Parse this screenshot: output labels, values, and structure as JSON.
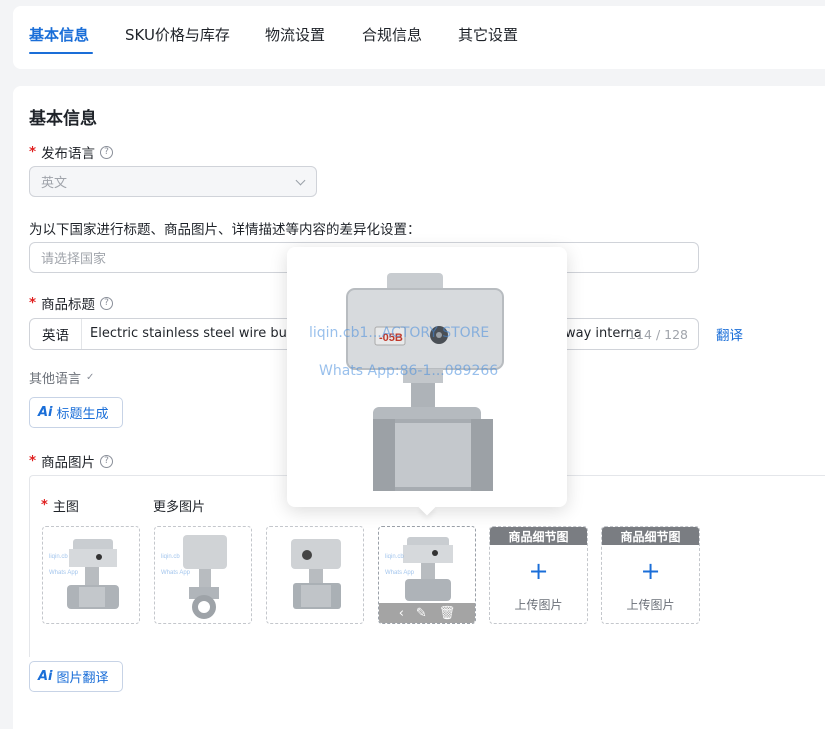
{
  "tabs": [
    {
      "label": "基本信息",
      "active": true
    },
    {
      "label": "SKU价格与库存",
      "active": false
    },
    {
      "label": "物流设置",
      "active": false
    },
    {
      "label": "合规信息",
      "active": false
    },
    {
      "label": "其它设置",
      "active": false
    }
  ],
  "basic": {
    "section_title": "基本信息",
    "language": {
      "label": "发布语言",
      "value": "英文"
    },
    "country": {
      "label": "为以下国家进行标题、商品图片、详情描述等内容的差异化设置：",
      "placeholder": "请选择国家"
    },
    "title": {
      "label": "商品标题",
      "lang": "英语",
      "value_head": "Electric stainless steel wire buckl",
      "value_tail": "way interna",
      "counter": "114 / 128",
      "translate_label": "翻译"
    },
    "other_lang_label": "其他语言",
    "ai_title_label": "标题生成",
    "ai_mark": "Ai",
    "images": {
      "label": "商品图片",
      "main_label": "主图",
      "more_label": "更多图片",
      "detail_head": "商品细节图",
      "upload_label": "上传图片",
      "plus": "+",
      "ai_translate_label": "图片翻译"
    }
  },
  "popover": {
    "watermark_1": "liqin.cb1...ACTORY STORE",
    "watermark_2": "Whats App:86-1...089266",
    "valve_code": "-05B"
  },
  "icons": {
    "help": "help-circle-icon",
    "chevron": "chevron-down-icon",
    "edit": "pencil-icon",
    "delete": "trash-icon",
    "prev": "chevron-left-icon"
  },
  "colors": {
    "accent": "#1a6ed8",
    "required": "#e02020",
    "detail_head_bg": "#7a7d82"
  }
}
